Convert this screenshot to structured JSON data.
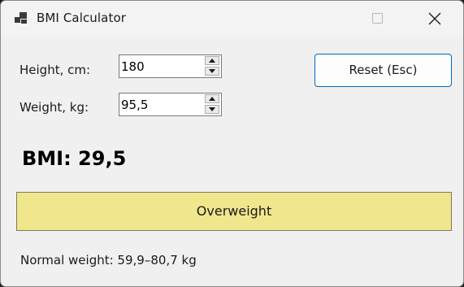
{
  "window": {
    "title": "BMI Calculator"
  },
  "form": {
    "height": {
      "label": "Height, cm:",
      "value": "180"
    },
    "weight": {
      "label": "Weight, kg:",
      "value": "95,5"
    },
    "reset_label": "Reset (Esc)"
  },
  "result": {
    "bmi_text": "BMI: 29,5",
    "category": "Overweight",
    "category_color": "#f0e68c",
    "normal_weight_text": "Normal weight: 59,9–80,7 kg"
  },
  "icons": {
    "app": "app-window-icon",
    "minimize": "minimize-icon",
    "maximize": "maximize-icon",
    "close": "close-icon",
    "spin_up": "chevron-up-icon",
    "spin_down": "chevron-down-icon"
  }
}
